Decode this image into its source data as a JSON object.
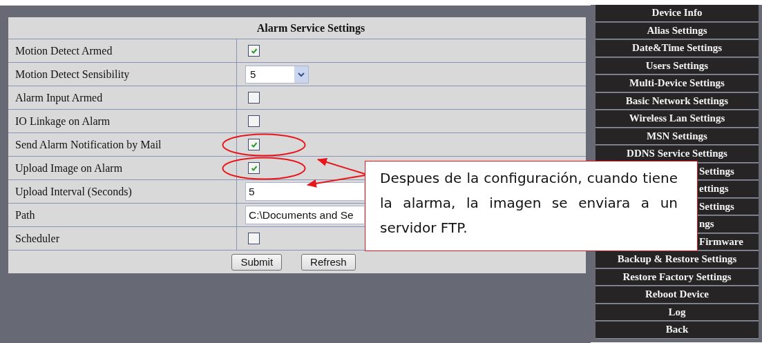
{
  "panel": {
    "title": "Alarm Service Settings",
    "rows": [
      {
        "label": "Motion Detect Armed",
        "kind": "checkbox",
        "checked": true,
        "circled": false
      },
      {
        "label": "Motion Detect Sensibility",
        "kind": "select",
        "value": "5",
        "circled": false
      },
      {
        "label": "Alarm Input Armed",
        "kind": "checkbox",
        "checked": false,
        "circled": false
      },
      {
        "label": "IO Linkage on Alarm",
        "kind": "checkbox",
        "checked": false,
        "circled": false
      },
      {
        "label": "Send Alarm Notification by Mail",
        "kind": "checkbox",
        "checked": true,
        "circled": true
      },
      {
        "label": "Upload Image on Alarm",
        "kind": "checkbox",
        "checked": true,
        "circled": true
      },
      {
        "label": "Upload Interval (Seconds)",
        "kind": "text",
        "value": "5",
        "circled": false
      },
      {
        "label": "Path",
        "kind": "text",
        "value": "C:\\Documents and Se",
        "circled": false
      },
      {
        "label": "Scheduler",
        "kind": "checkbox",
        "checked": false,
        "circled": false
      }
    ],
    "buttons": [
      "Submit",
      "Refresh"
    ]
  },
  "sidebar": {
    "items": [
      {
        "label": "Device Info",
        "kind": "full"
      },
      {
        "label": "Alias Settings",
        "kind": "full"
      },
      {
        "label": "Date&Time Settings",
        "kind": "full"
      },
      {
        "label": "Users Settings",
        "kind": "full"
      },
      {
        "label": "Multi-Device Settings",
        "kind": "full"
      },
      {
        "label": "Basic Network Settings",
        "kind": "full"
      },
      {
        "label": "Wireless Lan Settings",
        "kind": "full"
      },
      {
        "label": "MSN Settings",
        "kind": "full"
      },
      {
        "label": "DDNS Service Settings",
        "kind": "full"
      },
      {
        "label": "Settings",
        "kind": "partial"
      },
      {
        "label": "ettings",
        "kind": "partial"
      },
      {
        "label": "Settings",
        "kind": "partial"
      },
      {
        "label": "ngs",
        "kind": "partial"
      },
      {
        "label": "Firmware",
        "kind": "partial"
      },
      {
        "label": "Backup & Restore Settings",
        "kind": "full"
      },
      {
        "label": "Restore Factory Settings",
        "kind": "full"
      },
      {
        "label": "Reboot Device",
        "kind": "full"
      },
      {
        "label": "Log",
        "kind": "full"
      },
      {
        "label": "Back",
        "kind": "full"
      }
    ]
  },
  "callout": {
    "text": "Despues de la configuración, cuando tiene la alarma, la imagen se enviara a un servidor FTP."
  }
}
